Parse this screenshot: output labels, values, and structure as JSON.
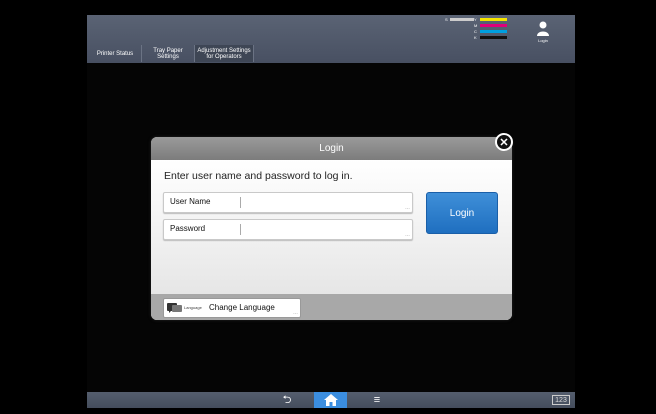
{
  "header": {
    "tabs": [
      {
        "label": "Printer Status"
      },
      {
        "label": "Tray Paper Settings"
      },
      {
        "label": "Adjustment Settings for Operators"
      }
    ],
    "toner": [
      {
        "letter": "Y",
        "color": "#f5e400"
      },
      {
        "letter": "M",
        "color": "#e0007a"
      },
      {
        "letter": "C",
        "color": "#00a0e0"
      },
      {
        "letter": "K",
        "color": "#111111"
      }
    ],
    "toner_side_label": "S",
    "login_label": "Login"
  },
  "dialog": {
    "title": "Login",
    "instruction": "Enter user name and password to log in.",
    "username_label": "User Name",
    "password_label": "Password",
    "login_button": "Login",
    "language_small": "Language",
    "change_language": "Change Language",
    "close_icon": "close-icon"
  },
  "footer": {
    "back_icon": "back-icon",
    "home_icon": "home-icon",
    "menu_icon": "menu-icon",
    "badge": "123"
  },
  "colors": {
    "accent": "#3b8ee0",
    "header_bg": "#525b6c",
    "login_button": "#2f7fd0"
  }
}
